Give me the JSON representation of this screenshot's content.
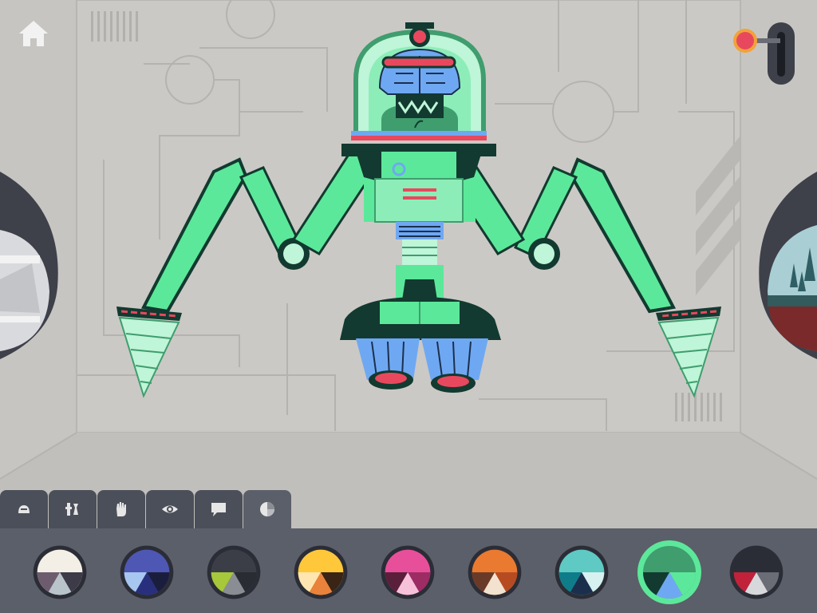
{
  "app": {
    "accent": "#5ce89a",
    "background": "#c7c5c1",
    "toolbar_bg": "#4b4f59",
    "palette_bg": "#5b5f69"
  },
  "toolbar": {
    "tabs": [
      {
        "id": "body",
        "icon": "robot-head-icon",
        "active": false
      },
      {
        "id": "parts",
        "icon": "wrench-parts-icon",
        "active": false
      },
      {
        "id": "hands",
        "icon": "hand-icon",
        "active": false
      },
      {
        "id": "eyes",
        "icon": "eye-icon",
        "active": false
      },
      {
        "id": "speech",
        "icon": "speech-bubble-icon",
        "active": false
      },
      {
        "id": "colors",
        "icon": "color-wheel-icon",
        "active": true
      }
    ]
  },
  "palette": {
    "selected_index": 7,
    "swatches": [
      {
        "name": "cream",
        "main": "#f4efe6",
        "a": "#6d5c6e",
        "b": "#b9c3ca",
        "c": "#3d3b48"
      },
      {
        "name": "indigo",
        "main": "#4e57b3",
        "a": "#a7c7f0",
        "b": "#28307d",
        "c": "#1b1d3d"
      },
      {
        "name": "charcoal",
        "main": "#3b3e47",
        "a": "#a6c83a",
        "b": "#8a8d94",
        "c": "#2a2c33"
      },
      {
        "name": "yellow",
        "main": "#ffc83a",
        "a": "#ffe6b0",
        "b": "#e9823a",
        "c": "#3a2416"
      },
      {
        "name": "pink",
        "main": "#e84f9a",
        "a": "#5a1f3b",
        "b": "#f7c2d9",
        "c": "#9c2c63"
      },
      {
        "name": "orange",
        "main": "#e97a2f",
        "a": "#6a3a28",
        "b": "#f2e2cf",
        "c": "#b64b22"
      },
      {
        "name": "teal",
        "main": "#5fc9c3",
        "a": "#0f7c8a",
        "b": "#1b2f4d",
        "c": "#d6f1ef"
      },
      {
        "name": "green",
        "main": "#3f9d6e",
        "a": "#123a30",
        "b": "#6fa8f2",
        "c": "#5ce89a"
      },
      {
        "name": "black",
        "main": "#2b2d36",
        "a": "#c2213a",
        "b": "#d6d8dc",
        "c": "#6a6d75"
      }
    ]
  }
}
